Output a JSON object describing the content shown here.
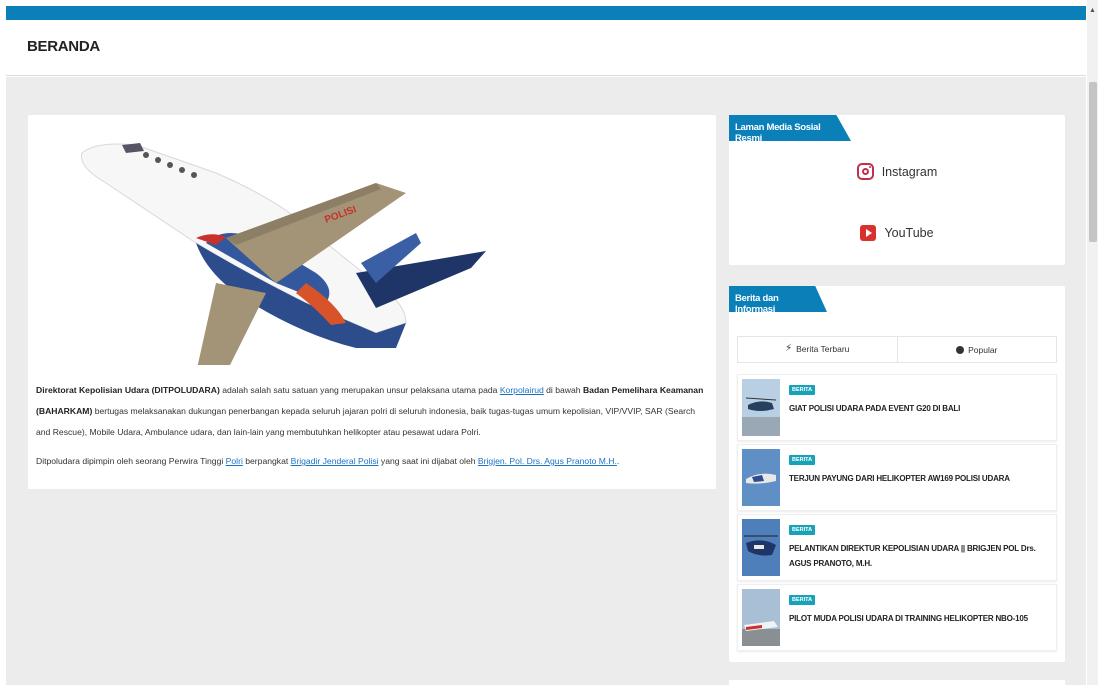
{
  "header": {
    "title": "BERANDA"
  },
  "main": {
    "paragraph1": {
      "org_name": "Direktorat Kepolisian Udara (DITPOLUDARA)",
      "text1": " adalah salah satu satuan yang merupakan unsur pelaksana utama pada ",
      "link1": "Korpolairud",
      "text2": " di bawah ",
      "baharkam": "Badan Pemelihara Keamanan (BAHARKAM)",
      "text3": " bertugas melaksanakan dukungan penerbangan kepada seluruh jajaran polri di seluruh indonesia, baik tugas-tugas umum kepolisian, VIP/VVIP, SAR (Search and Rescue), Mobile Udara, Ambulance udara, dan lain-lain yang membutuhkan helikopter atau pesawat udara Polri."
    },
    "paragraph2": {
      "text1": "Ditpoludara dipimpin oleh seorang Perwira Tinggi ",
      "link1": "Polri",
      "text2": " berpangkat ",
      "link2": "Brigadir Jenderal Polisi",
      "text3": " yang saat ini dijabat oleh ",
      "link3": "Brigjen. Pol. Drs. Agus Pranoto M.H.",
      "text4": "."
    },
    "image_text": "POLISI"
  },
  "social": {
    "title": "Laman Media Sosial Resmi",
    "instagram": "Instagram",
    "youtube": "YouTube"
  },
  "news": {
    "title": "Berita dan Informasi",
    "tab_latest": "Berita Terbaru",
    "tab_popular": "Popular",
    "items": [
      {
        "badge": "BERITA",
        "title": "GIAT POLISI UDARA PADA EVENT G20 DI BALI"
      },
      {
        "badge": "BERITA",
        "title": "TERJUN PAYUNG DARI HELIKOPTER AW169 POLISI UDARA"
      },
      {
        "badge": "BERITA",
        "title": "PELANTIKAN DIREKTUR KEPOLISIAN UDARA || BRIGJEN POL Drs. AGUS PRANOTO, M.H."
      },
      {
        "badge": "BERITA",
        "title": "PILOT MUDA POLISI UDARA DI TRAINING HELIKOPTER NBO-105"
      }
    ]
  },
  "colors": {
    "brand": "#0a7fb8",
    "badge": "#17a2b8",
    "instagram": "#c0304d",
    "youtube": "#d9322c"
  }
}
